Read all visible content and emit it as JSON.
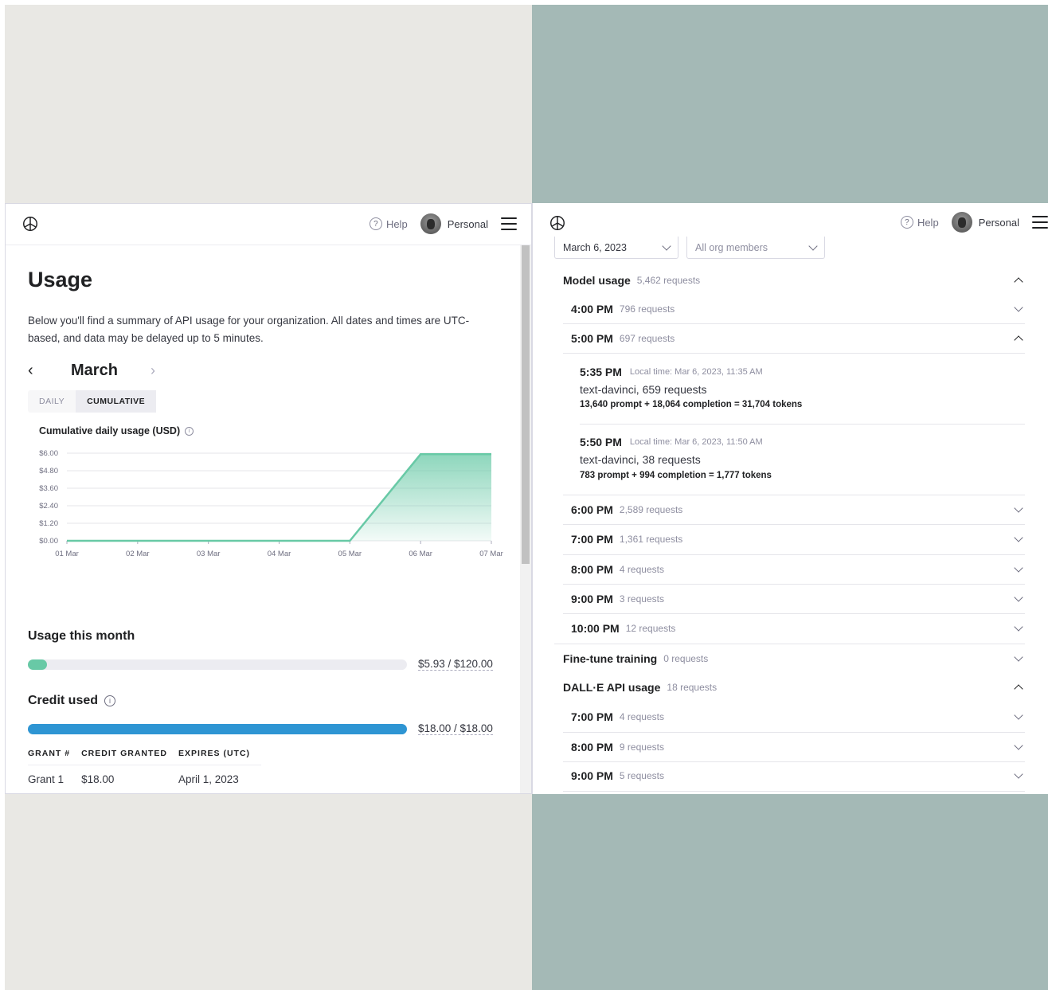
{
  "topbar": {
    "help_label": "Help",
    "org_label": "Personal"
  },
  "left": {
    "title": "Usage",
    "description": "Below you'll find a summary of API usage for your organization. All dates and times are UTC-based, and data may be delayed up to 5 minutes.",
    "month": "March",
    "tabs": [
      "DAILY",
      "CUMULATIVE"
    ],
    "chart_title": "Cumulative daily usage (USD)",
    "usage_month_title": "Usage this month",
    "usage_month_amount": "$5.93 / $120.00",
    "usage_month_fraction": 0.0494,
    "credit_title": "Credit used",
    "credit_amount": "$18.00 / $18.00",
    "credit_fraction": 1.0,
    "grant_headers": [
      "GRANT #",
      "CREDIT GRANTED",
      "EXPIRES (UTC)"
    ],
    "grant_rows": [
      [
        "Grant 1",
        "$18.00",
        "April 1, 2023"
      ]
    ],
    "colors": {
      "usage_bar": "#68c9a6",
      "credit_bar": "#2e95d3",
      "chart_line": "#68c9a6"
    }
  },
  "chart_data": {
    "type": "area",
    "title": "Cumulative daily usage (USD)",
    "categories": [
      "01 Mar",
      "02 Mar",
      "03 Mar",
      "04 Mar",
      "05 Mar",
      "06 Mar",
      "07 Mar"
    ],
    "values": [
      0,
      0,
      0,
      0,
      0,
      5.93,
      5.93
    ],
    "y_ticks": [
      "$0.00",
      "$1.20",
      "$2.40",
      "$3.60",
      "$4.80",
      "$6.00"
    ],
    "ylim": [
      0,
      6
    ],
    "grid": true
  },
  "right": {
    "date_filter": "March 6, 2023",
    "member_filter": "All org members",
    "model_usage": {
      "label": "Model usage",
      "count": "5,462 requests"
    },
    "model_hours": [
      {
        "time": "4:00 PM",
        "count": "796 requests",
        "expanded": false
      },
      {
        "time": "5:00 PM",
        "count": "697 requests",
        "expanded": true
      }
    ],
    "details": [
      {
        "time": "5:35 PM",
        "local": "Local time: Mar 6, 2023, 11:35 AM",
        "model": "text-davinci, 659 requests",
        "tokens": "13,640 prompt + 18,064 completion = 31,704 tokens"
      },
      {
        "time": "5:50 PM",
        "local": "Local time: Mar 6, 2023, 11:50 AM",
        "model": "text-davinci, 38 requests",
        "tokens": "783 prompt + 994 completion = 1,777 tokens"
      }
    ],
    "model_hours_after": [
      {
        "time": "6:00 PM",
        "count": "2,589 requests"
      },
      {
        "time": "7:00 PM",
        "count": "1,361 requests"
      },
      {
        "time": "8:00 PM",
        "count": "4 requests"
      },
      {
        "time": "9:00 PM",
        "count": "3 requests"
      },
      {
        "time": "10:00 PM",
        "count": "12 requests"
      }
    ],
    "fine_tune": {
      "label": "Fine-tune training",
      "count": "0 requests"
    },
    "dalle": {
      "label": "DALL·E API usage",
      "count": "18 requests"
    },
    "dalle_hours": [
      {
        "time": "7:00 PM",
        "count": "4 requests"
      },
      {
        "time": "8:00 PM",
        "count": "9 requests"
      },
      {
        "time": "9:00 PM",
        "count": "5 requests"
      }
    ]
  }
}
